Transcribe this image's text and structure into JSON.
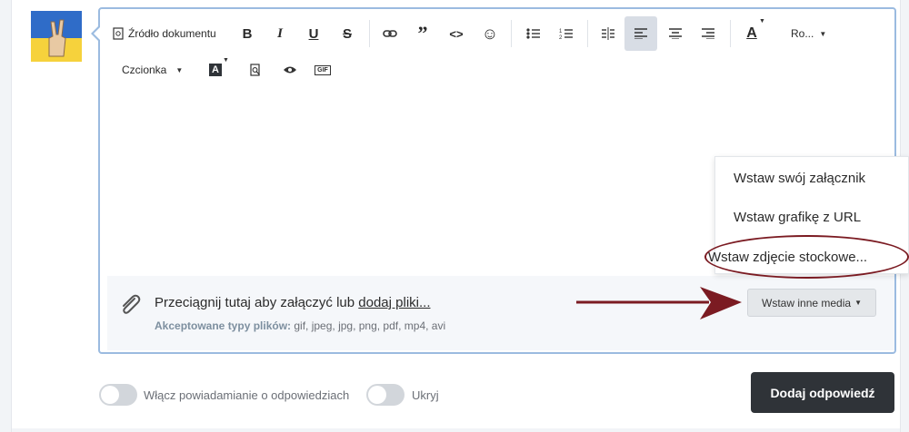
{
  "toolbar": {
    "source_label": "Źródło dokumentu",
    "icons": {
      "bold": "B",
      "italic": "I",
      "underline": "U",
      "strike": "S",
      "link": "🔗",
      "quote": "”",
      "code": "<>",
      "smilie": "☺",
      "list_bullet": "≡",
      "list_number": "≣",
      "align_justify": "⇹",
      "align_left": "≡",
      "align_center": "≡",
      "align_right": "≡",
      "text_color": "A",
      "bg_color": "A",
      "gif": "GIF"
    },
    "font_size_label": "Ro...",
    "font_label": "Czcionka"
  },
  "dropzone": {
    "text": "Przeciągnij tutaj aby załączyć lub ",
    "link": "dodaj pliki...",
    "accepted_label": "Akceptowane typy plików:",
    "accepted_types": " gif, jpeg, jpg, png, pdf, mp4, avi"
  },
  "media_button": "Wstaw inne media",
  "menu": {
    "items": [
      "Wstaw swój załącznik",
      "Wstaw grafikę z URL",
      "Wstaw zdjęcie stockowe..."
    ]
  },
  "toggles": {
    "notify_label": "Włącz powiadamianie o odpowiedziach",
    "hide_label": "Ukryj"
  },
  "submit_label": "Dodaj odpowiedź",
  "colors": {
    "editor_border": "#9bbbe0",
    "annotation": "#7b1b22",
    "submit_bg": "#2f3338"
  }
}
